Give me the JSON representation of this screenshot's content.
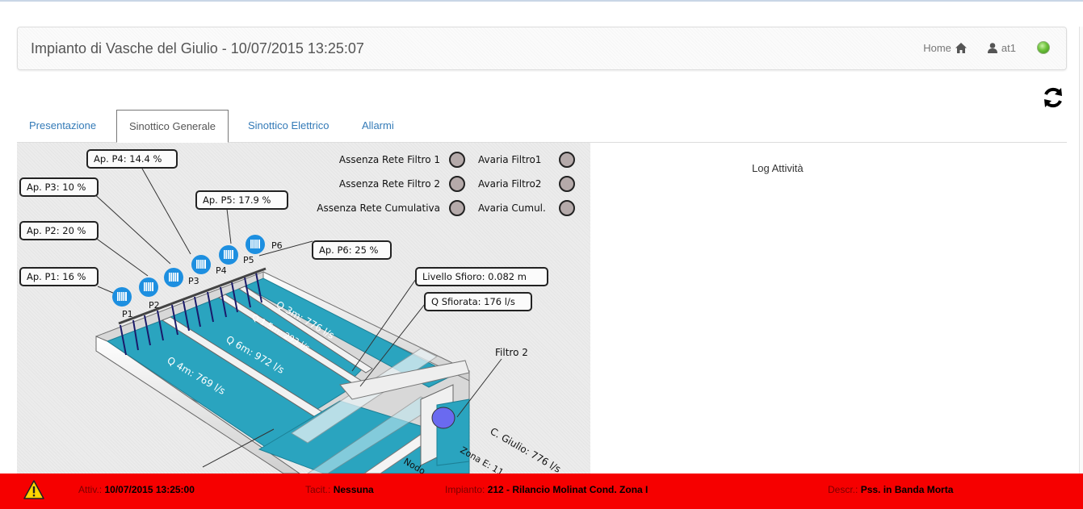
{
  "header": {
    "title": "Impianto di Vasche del Giulio - 10/07/2015 13:25:07",
    "home_label": "Home",
    "user_label": "at1"
  },
  "tabs": [
    {
      "label": "Presentazione",
      "active": false
    },
    {
      "label": "Sinottico Generale",
      "active": true
    },
    {
      "label": "Sinottico Elettrico",
      "active": false
    },
    {
      "label": "Allarmi",
      "active": false
    }
  ],
  "synoptic": {
    "status_indicators": [
      {
        "label": "Assenza Rete Filtro 1"
      },
      {
        "label": "Assenza Rete Filtro 2"
      },
      {
        "label": "Assenza Rete Cumulativa"
      },
      {
        "label": "Avaria Filtro1"
      },
      {
        "label": "Avaria Filtro2"
      },
      {
        "label": "Avaria Cumul."
      }
    ],
    "callouts": {
      "p4": "Ap. P4: 14.4 %",
      "p3": "Ap. P3: 10 %",
      "p5": "Ap. P5: 17.9 %",
      "p2": "Ap. P2: 20 %",
      "p6": "Ap. P6: 25 %",
      "p1": "Ap. P1: 16 %",
      "livello": "Livello Sfioro: 0.082 m",
      "q_sfiorata": "Q Sfiorata: 176 l/s"
    },
    "pumps": [
      "P1",
      "P2",
      "P3",
      "P4",
      "P5",
      "P6"
    ],
    "basins": {
      "q3m": "Q 3m: 776 l/s",
      "q15m": "Q 1.5m: 293 l/s",
      "q6m": "Q 6m: 972 l/s",
      "q4m": "Q 4m: 769 l/s"
    },
    "filtro2": "Filtro 2",
    "c_giulio": "C. Giulio: 776 l/s",
    "zona_e": "Zona E: 11",
    "nodo": "Nodo"
  },
  "log": {
    "title": "Log Attività"
  },
  "alarm": {
    "attiv_label": "Attiv.:",
    "attiv_value": "10/07/2015 13:25:00",
    "tacit_label": "Tacit.:",
    "tacit_value": "Nessuna",
    "impianto_label": "Impianto:",
    "impianto_value": "212 - Rilancio Molinat Cond. Zona I",
    "descr_label": "Descr.:",
    "descr_value": "Pss. in Banda Morta"
  },
  "colors": {
    "alarm_red": "#f60000",
    "water": "#2aa4bf",
    "pump_blue": "#1d8fe0",
    "indicator_grey": "#b5aaaa",
    "tab_link": "#337ab7"
  },
  "icons": [
    "home-icon",
    "user-icon",
    "status-led-icon",
    "refresh-icon",
    "warning-icon",
    "pump-icon"
  ]
}
